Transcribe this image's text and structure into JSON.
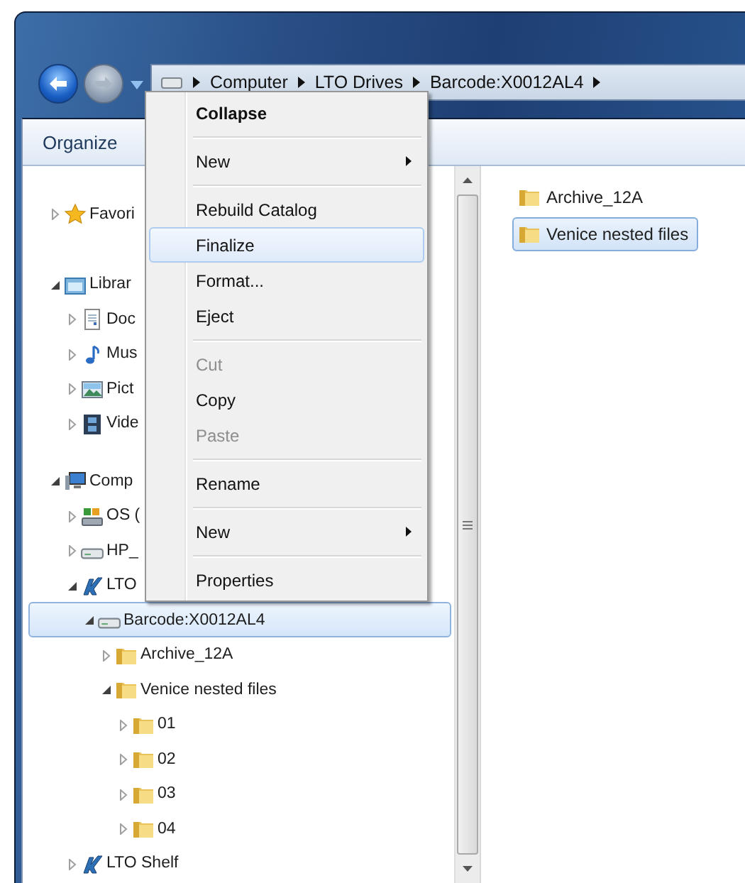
{
  "navigation": {
    "back_enabled": true,
    "forward_enabled": false
  },
  "address_bar": {
    "segments": [
      "Computer",
      "LTO Drives",
      "Barcode:X0012AL4"
    ]
  },
  "toolbar": {
    "organize": "Organize"
  },
  "nav_tree": [
    {
      "label": "Favori",
      "kind": "favorites",
      "expanded": false,
      "selected": false
    },
    {
      "label": "Librar",
      "kind": "libraries",
      "expanded": true,
      "selected": false,
      "children": [
        {
          "label": "Doc",
          "kind": "documents",
          "expanded": false,
          "selected": false
        },
        {
          "label": "Mus",
          "kind": "music",
          "expanded": false,
          "selected": false
        },
        {
          "label": "Pict",
          "kind": "pictures",
          "expanded": false,
          "selected": false
        },
        {
          "label": "Vide",
          "kind": "videos",
          "expanded": false,
          "selected": false
        }
      ]
    },
    {
      "label": "Comp",
      "kind": "computer",
      "expanded": true,
      "selected": false,
      "children": [
        {
          "label": "OS (",
          "kind": "system-drive",
          "expanded": false,
          "selected": false
        },
        {
          "label": "HP_",
          "kind": "drive",
          "expanded": false,
          "selected": false
        },
        {
          "label": "LTO",
          "kind": "tape",
          "expanded": true,
          "selected": false,
          "children": [
            {
              "label": "Barcode:X0012AL4",
              "kind": "drive",
              "expanded": true,
              "selected": true,
              "children": [
                {
                  "label": "Archive_12A",
                  "kind": "folder",
                  "expanded": false,
                  "selected": false
                },
                {
                  "label": "Venice nested files",
                  "kind": "folder",
                  "expanded": true,
                  "selected": false,
                  "children": [
                    {
                      "label": "01",
                      "kind": "folder",
                      "expanded": false,
                      "selected": false
                    },
                    {
                      "label": "02",
                      "kind": "folder",
                      "expanded": false,
                      "selected": false
                    },
                    {
                      "label": "03",
                      "kind": "folder",
                      "expanded": false,
                      "selected": false
                    },
                    {
                      "label": "04",
                      "kind": "folder",
                      "expanded": false,
                      "selected": false
                    }
                  ]
                }
              ]
            }
          ]
        },
        {
          "label": "LTO Shelf",
          "kind": "tape",
          "expanded": false,
          "selected": false
        }
      ]
    }
  ],
  "files": [
    {
      "name": "Archive_12A",
      "selected": false
    },
    {
      "name": "Venice nested files",
      "selected": true
    }
  ],
  "context_menu": {
    "groups": [
      [
        {
          "label": "Collapse",
          "default": true,
          "disabled": false,
          "selected": false,
          "submenu": false
        }
      ],
      [
        {
          "label": "New",
          "default": false,
          "disabled": false,
          "selected": false,
          "submenu": true
        }
      ],
      [
        {
          "label": "Rebuild Catalog",
          "default": false,
          "disabled": false,
          "selected": false,
          "submenu": false
        },
        {
          "label": "Finalize",
          "default": false,
          "disabled": false,
          "selected": true,
          "submenu": false
        },
        {
          "label": "Format...",
          "default": false,
          "disabled": false,
          "selected": false,
          "submenu": false
        },
        {
          "label": "Eject",
          "default": false,
          "disabled": false,
          "selected": false,
          "submenu": false
        }
      ],
      [
        {
          "label": "Cut",
          "default": false,
          "disabled": true,
          "selected": false,
          "submenu": false
        },
        {
          "label": "Copy",
          "default": false,
          "disabled": false,
          "selected": false,
          "submenu": false
        },
        {
          "label": "Paste",
          "default": false,
          "disabled": true,
          "selected": false,
          "submenu": false
        }
      ],
      [
        {
          "label": "Rename",
          "default": false,
          "disabled": false,
          "selected": false,
          "submenu": false
        }
      ],
      [
        {
          "label": "New",
          "default": false,
          "disabled": false,
          "selected": false,
          "submenu": true
        }
      ],
      [
        {
          "label": "Properties",
          "default": false,
          "disabled": false,
          "selected": false,
          "submenu": false
        }
      ]
    ]
  }
}
